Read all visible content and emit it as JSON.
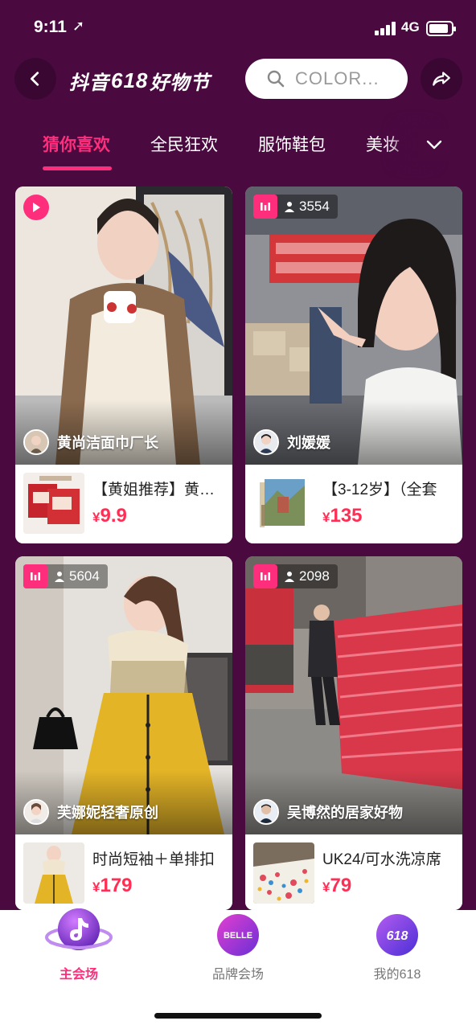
{
  "status_bar": {
    "time": "9:11",
    "network": "4G"
  },
  "header": {
    "logo": {
      "pre": "抖音",
      "num": "618",
      "post": "好物节"
    },
    "search_placeholder": "COLOR..."
  },
  "tabs": [
    {
      "label": "猜你喜欢",
      "active": true
    },
    {
      "label": "全民狂欢",
      "active": false
    },
    {
      "label": "服饰鞋包",
      "active": false
    },
    {
      "label": "美妆",
      "active": false
    }
  ],
  "cards": [
    {
      "badge": "video",
      "viewers": "",
      "author": "黄尚洁面巾厂长",
      "product_title": "【黄姐推荐】黄尚洁面巾",
      "price_currency": "¥",
      "price": "9.9"
    },
    {
      "badge": "live",
      "viewers": "3554",
      "author": "刘媛媛",
      "product_title": "【3-12岁】（全套",
      "price_currency": "¥",
      "price": "135"
    },
    {
      "badge": "live",
      "viewers": "5604",
      "author": "芙娜妮轻奢原创",
      "product_title": "时尚短袖＋单排扣",
      "price_currency": "¥",
      "price": "179"
    },
    {
      "badge": "live",
      "viewers": "2098",
      "author": "吴博然的居家好物",
      "product_title": "UK24/可水洗凉席",
      "price_currency": "¥",
      "price": "79"
    }
  ],
  "bottom_nav": [
    {
      "label": "主会场",
      "active": true
    },
    {
      "label": "品牌会场",
      "active": false,
      "icon_text": "BELLE"
    },
    {
      "label": "我的618",
      "active": false,
      "icon_text": "618"
    }
  ],
  "colors": {
    "background": "#4a0a40",
    "accent": "#ff2e7d",
    "price": "#ff2e55"
  }
}
